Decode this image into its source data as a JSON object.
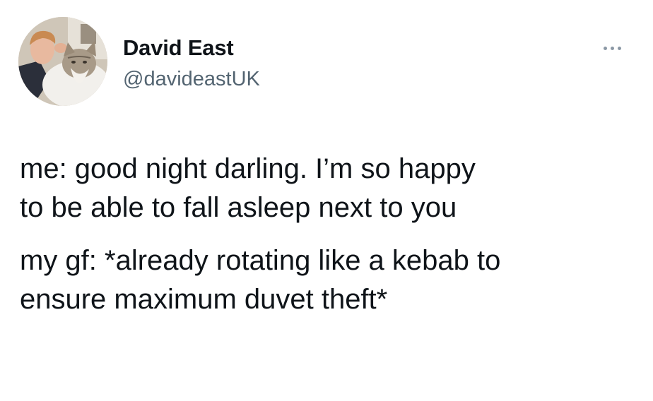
{
  "tweet": {
    "author": {
      "display_name": "David East",
      "handle": "@davideastUK",
      "avatar_icon": "profile-photo-with-cat"
    },
    "more_icon": "more-horizontal-icon",
    "paragraphs": [
      "me: good night darling. I’m so happy\nto be able to fall asleep next to you",
      "my gf: *already rotating like a kebab to\nensure maximum duvet theft*"
    ]
  },
  "colors": {
    "text_primary": "#0f1419",
    "text_secondary": "#536471",
    "background": "#ffffff"
  }
}
